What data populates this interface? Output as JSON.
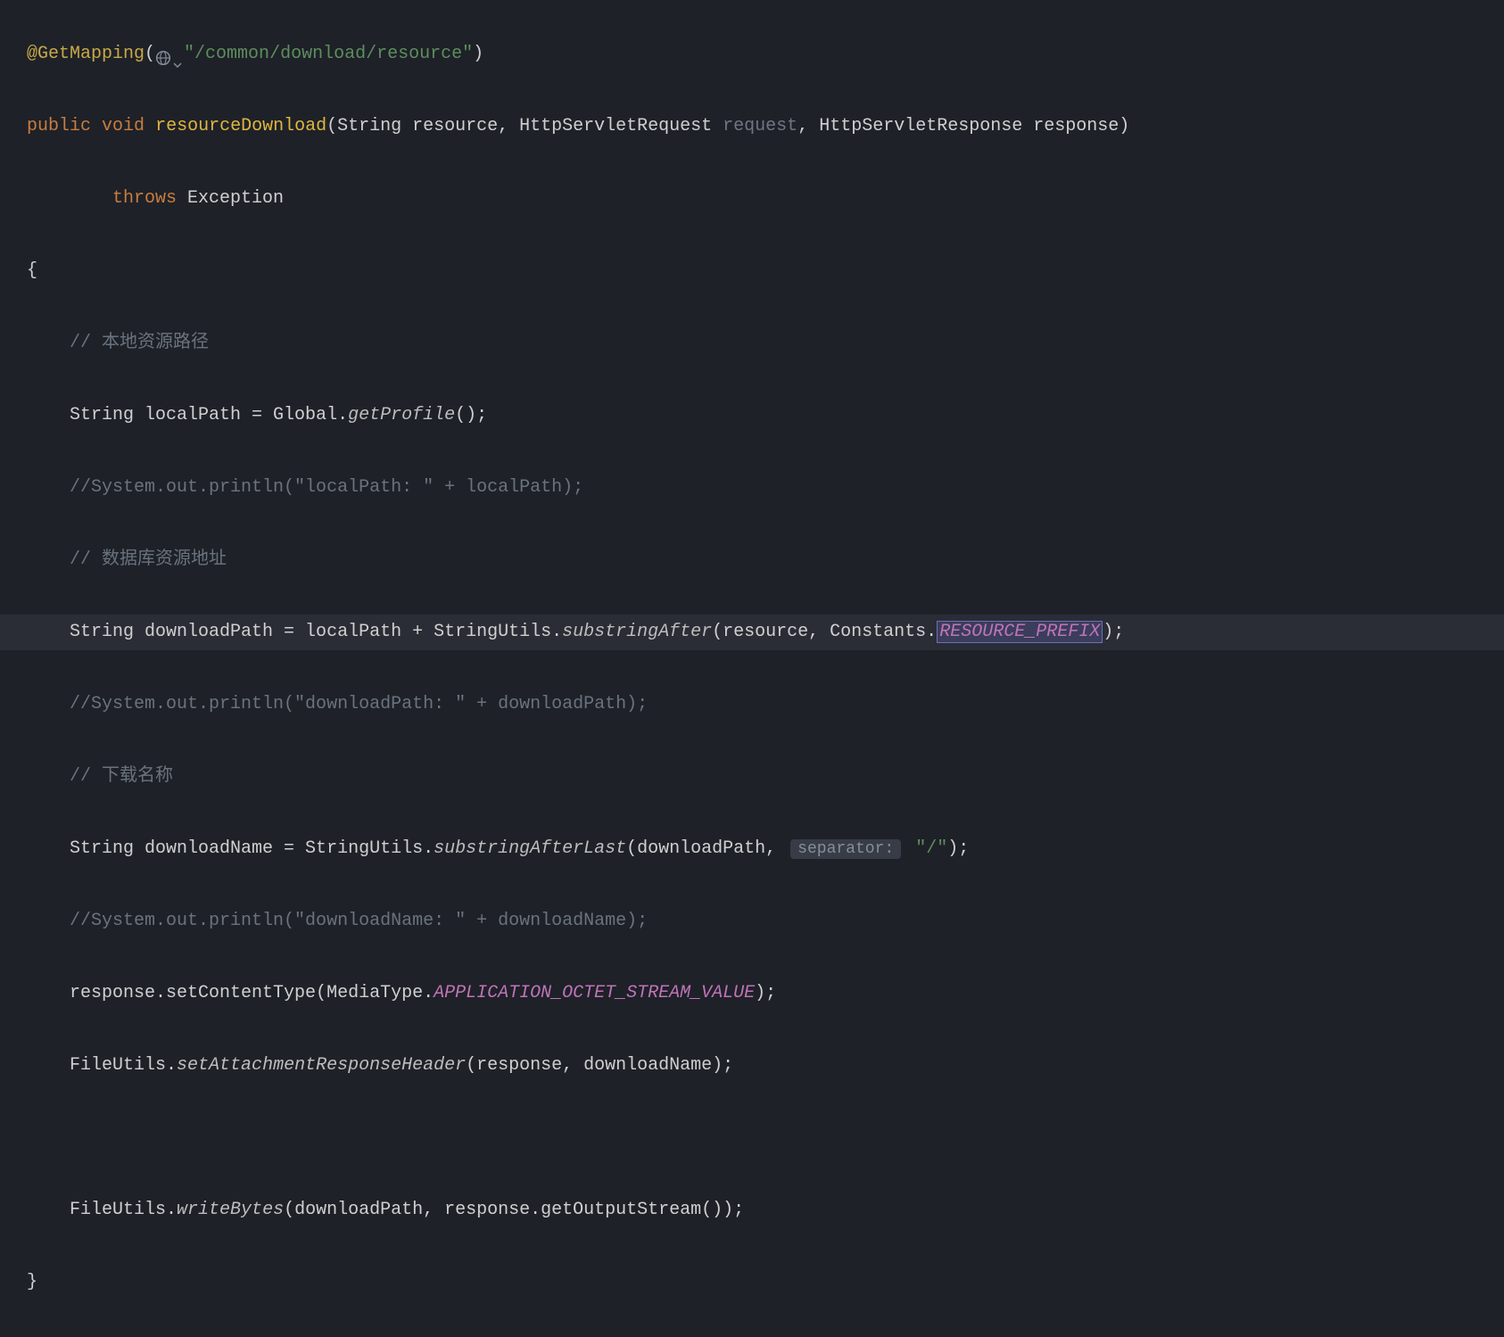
{
  "code": {
    "line1": {
      "annotation": "@GetMapping",
      "paren_open": "(",
      "icon_globe": "globe-icon",
      "icon_chevron": "chevron-down-icon",
      "string": "\"/common/download/resource\"",
      "paren_close": ")"
    },
    "line2": {
      "kw_public": "public",
      "kw_void": "void",
      "method": "resourceDownload",
      "params": "(String resource, HttpServletRequest ",
      "unused": "request",
      "params_after": ", HttpServletResponse response)"
    },
    "line3": {
      "kw_throws": "throws",
      "exception": " Exception"
    },
    "line4": "{",
    "line5": "// 本地资源路径",
    "line6": {
      "prefix": "String localPath = Global.",
      "method": "getProfile",
      "suffix": "();"
    },
    "line7": "//System.out.println(\"localPath: \" + localPath);",
    "line8": "// 数据库资源地址",
    "line9": {
      "prefix": "String downloadPath = localPath + StringUtils.",
      "method": "substringAfter",
      "mid": "(resource, Constants.",
      "constant": "RESOURCE_PREFIX",
      "suffix": ");"
    },
    "line10": "//System.out.println(\"downloadPath: \" + downloadPath);",
    "line11": "// 下载名称",
    "line12": {
      "prefix": "String downloadName = StringUtils.",
      "method": "substringAfterLast",
      "mid": "(downloadPath, ",
      "hint": "separator:",
      "string": " \"/\"",
      "suffix": ");"
    },
    "line13": "//System.out.println(\"downloadName: \" + downloadName);",
    "line14": {
      "prefix": "response.setContentType(MediaType.",
      "constant": "APPLICATION_OCTET_STREAM_VALUE",
      "suffix": ");"
    },
    "line15": {
      "prefix": "FileUtils.",
      "method": "setAttachmentResponseHeader",
      "suffix": "(response, downloadName);"
    },
    "line16": "",
    "line17": {
      "prefix": "FileUtils.",
      "method": "writeBytes",
      "suffix": "(downloadPath, response.getOutputStream());"
    },
    "line18": "}"
  }
}
